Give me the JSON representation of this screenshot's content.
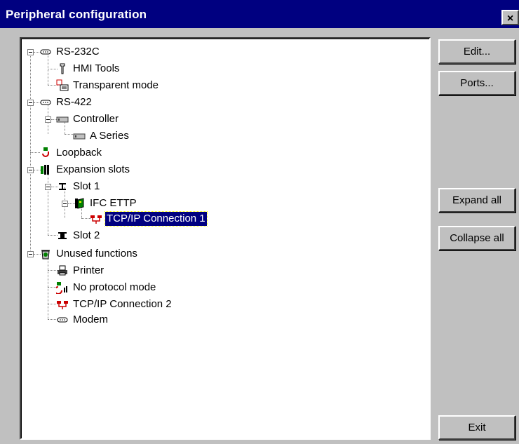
{
  "window": {
    "title": "Peripheral configuration",
    "close_label": "×"
  },
  "buttons": {
    "edit": {
      "label": "Edit...",
      "mnemonic": "E"
    },
    "ports": {
      "label": "Ports...",
      "mnemonic": "P"
    },
    "expand_all": {
      "label": "Expand all",
      "mnemonic": "E"
    },
    "collapse_all": {
      "label": "Collapse all",
      "mnemonic": "C"
    },
    "exit": {
      "label": "Exit",
      "mnemonic": "x"
    }
  },
  "tree": [
    {
      "label": "RS-232C",
      "icon": "serial-port-icon"
    },
    {
      "label": "HMI Tools",
      "icon": "tool-icon"
    },
    {
      "label": "Transparent mode",
      "icon": "transparent-mode-icon"
    },
    {
      "label": "RS-422",
      "icon": "serial-port-icon"
    },
    {
      "label": "Controller",
      "icon": "controller-icon"
    },
    {
      "label": "A Series",
      "icon": "controller-icon"
    },
    {
      "label": "Loopback",
      "icon": "loopback-icon"
    },
    {
      "label": "Expansion slots",
      "icon": "expansion-slots-icon"
    },
    {
      "label": "Slot 1",
      "icon": "slot-icon"
    },
    {
      "label": "IFC ETTP",
      "icon": "card-icon"
    },
    {
      "label": "TCP/IP Connection 1",
      "icon": "network-icon",
      "selected": true
    },
    {
      "label": "Slot 2",
      "icon": "slot-icon"
    },
    {
      "label": "Unused functions",
      "icon": "recycle-bin-icon"
    },
    {
      "label": "Printer",
      "icon": "printer-icon"
    },
    {
      "label": "No protocol mode",
      "icon": "no-protocol-icon"
    },
    {
      "label": "TCP/IP Connection 2",
      "icon": "network-icon"
    },
    {
      "label": "Modem",
      "icon": "modem-icon"
    }
  ],
  "colors": {
    "titlebar": "#000080",
    "face": "#c0c0c0",
    "selection": "#000080"
  }
}
